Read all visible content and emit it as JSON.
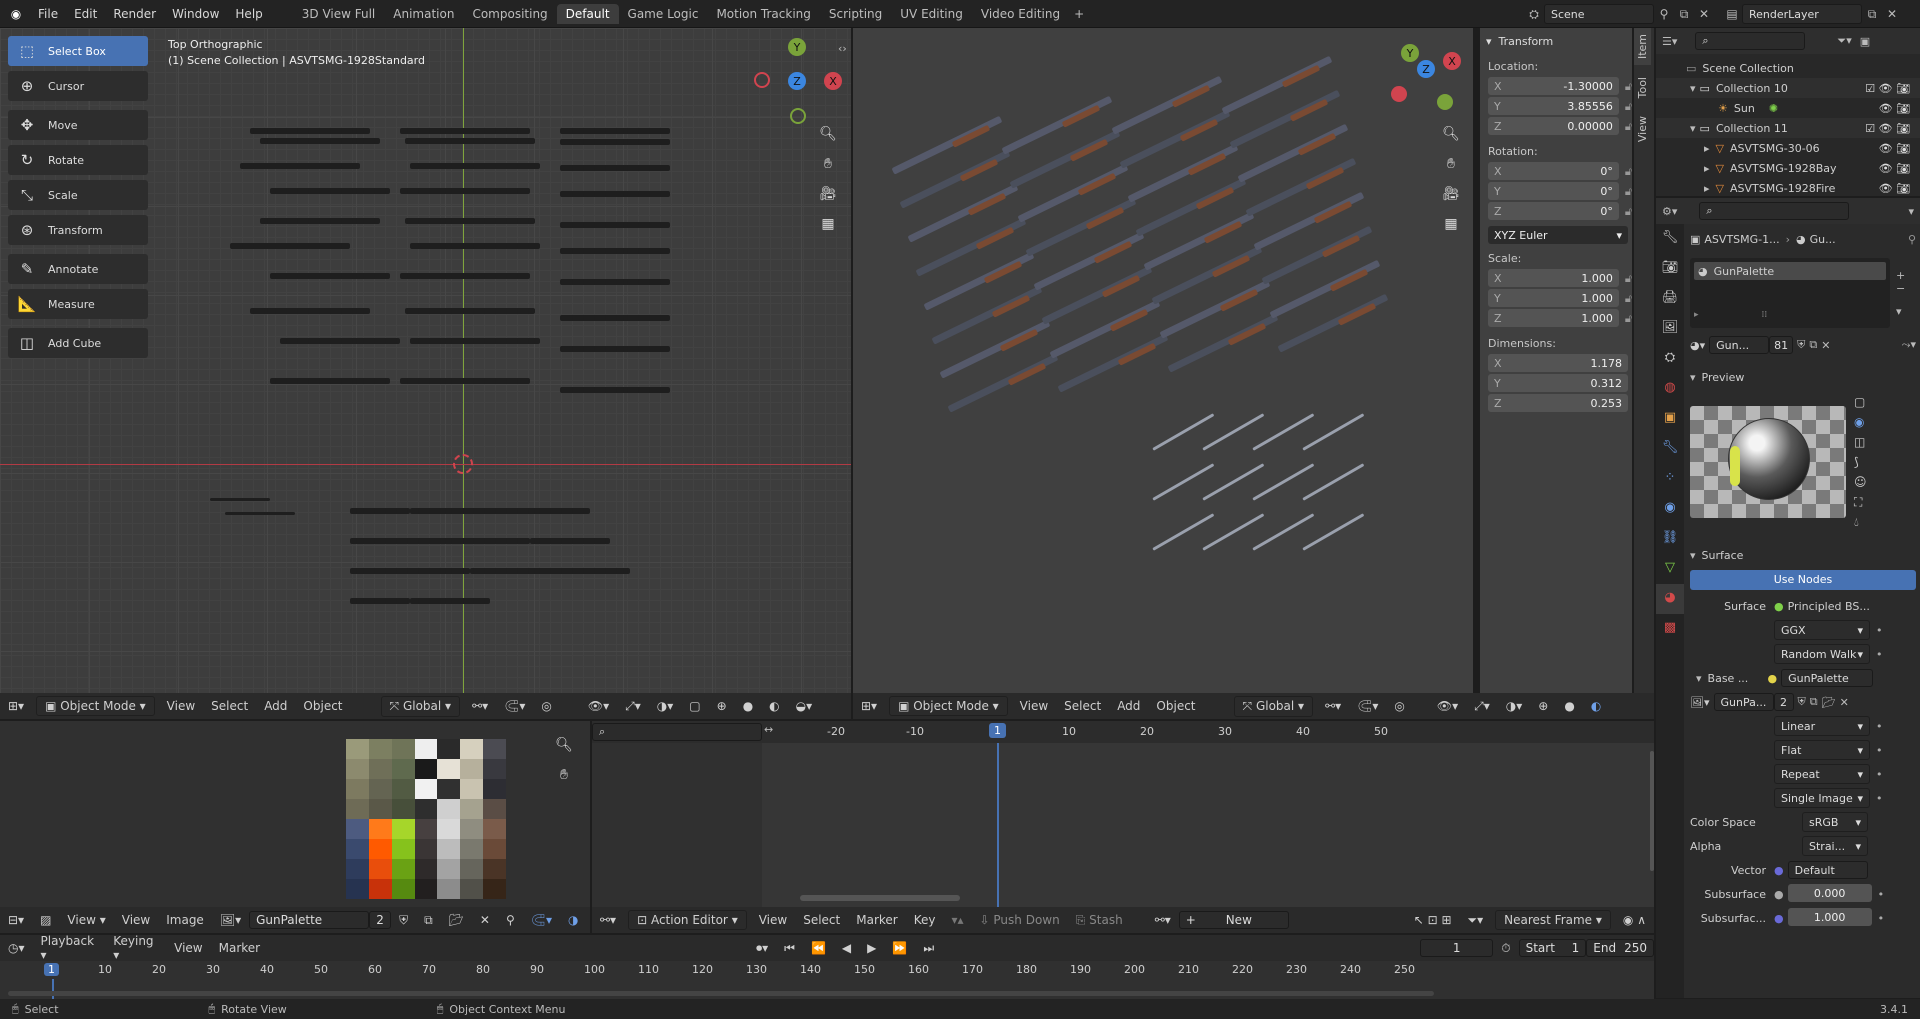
{
  "top_menu": [
    "File",
    "Edit",
    "Render",
    "Window",
    "Help"
  ],
  "workspaces": [
    "3D View Full",
    "Animation",
    "Compositing",
    "Default",
    "Game Logic",
    "Motion Tracking",
    "Scripting",
    "UV Editing",
    "Video Editing"
  ],
  "active_workspace": "Default",
  "scene": {
    "name": "Scene",
    "render_layer": "RenderLayer"
  },
  "left_viewport": {
    "view_name": "Top Orthographic",
    "collection_text": "(1) Scene Collection | ASVTSMG-1928Standard",
    "tools": [
      "Select Box",
      "Cursor",
      "Move",
      "Rotate",
      "Scale",
      "Transform",
      "Annotate",
      "Measure",
      "Add Cube"
    ],
    "header": {
      "mode": "Object Mode",
      "menus": [
        "View",
        "Select",
        "Add",
        "Object"
      ],
      "orientation": "Global"
    },
    "gizmo": {
      "y": "Y",
      "z": "Z",
      "x": "X"
    }
  },
  "right_viewport": {
    "header": {
      "mode": "Object Mode",
      "menus": [
        "View",
        "Select",
        "Add",
        "Object"
      ],
      "orientation": "Global"
    },
    "side_tabs": [
      "Item",
      "Tool",
      "View"
    ],
    "transform": {
      "title": "Transform",
      "location_label": "Location:",
      "location": {
        "x": "-1.30000",
        "y": "3.85556",
        "z": "0.00000"
      },
      "rotation_label": "Rotation:",
      "rotation": {
        "x": "0°",
        "y": "0°",
        "z": "0°"
      },
      "rotation_mode": "XYZ Euler",
      "scale_label": "Scale:",
      "scale": {
        "x": "1.000",
        "y": "1.000",
        "z": "1.000"
      },
      "dimensions_label": "Dimensions:",
      "dimensions": {
        "x": "1.178",
        "y": "0.312",
        "z": "0.253"
      },
      "axis_labels": {
        "x": "X",
        "y": "Y",
        "z": "Z"
      }
    }
  },
  "outliner": {
    "items": [
      {
        "name": "Scene Collection",
        "indent": 0
      },
      {
        "name": "Collection 10",
        "indent": 1
      },
      {
        "name": "Sun",
        "indent": 2
      },
      {
        "name": "Collection 11",
        "indent": 1
      },
      {
        "name": "ASVTSMG-30-06",
        "indent": 2
      },
      {
        "name": "ASVTSMG-1928Bay",
        "indent": 2
      },
      {
        "name": "ASVTSMG-1928Fire",
        "indent": 2
      }
    ]
  },
  "properties": {
    "breadcrumb_object": "ASVTSMG-1...",
    "breadcrumb_material": "Gu...",
    "material_slot": "GunPalette",
    "material_name": "Gun...",
    "material_users": "81",
    "preview_label": "Preview",
    "surface_section": "Surface",
    "use_nodes": "Use Nodes",
    "surface_label": "Surface",
    "surface_value": "Principled BS...",
    "distribution": "GGX",
    "subsurface_method": "Random Walk",
    "base_color_label": "Base ...",
    "base_color_value": "GunPalette",
    "image_name": "GunPa...",
    "image_users": "2",
    "interpolation": "Linear",
    "projection": "Flat",
    "extension": "Repeat",
    "source": "Single Image",
    "color_space_label": "Color Space",
    "color_space": "sRGB",
    "alpha_label": "Alpha",
    "alpha_value": "Strai...",
    "vector_label": "Vector",
    "vector_value": "Default",
    "subsurface_label": "Subsurface",
    "subsurface_value": "0.000",
    "subsurface2_label": "Subsurfac...",
    "subsurface2_value": "1.000"
  },
  "image_editor": {
    "menus": [
      "View",
      "View",
      "Image"
    ],
    "image_name": "GunPalette",
    "users": "2",
    "palette": [
      [
        "#9a9a7a",
        "#7c7f61",
        "#6f7458",
        "#eeeeee",
        "#2a2a2a",
        "#d6d0be",
        "#4b4b52"
      ],
      [
        "#8c8a6e",
        "#6f6f58",
        "#5f6a4e",
        "#1a1a1a",
        "#e6e1d6",
        "#b6b09c",
        "#39393f"
      ],
      [
        "#7d7a60",
        "#646452",
        "#525b43",
        "#f1f1f1",
        "#303030",
        "#c9c3b0",
        "#2d2d33"
      ],
      [
        "#6e6b56",
        "#5a5848",
        "#474f3a",
        "#2e2e2e",
        "#cfcfcf",
        "#a5a28f",
        "#5a4d45"
      ],
      [
        "#4d5b80",
        "#ff7a1a",
        "#a6d62a",
        "#474040",
        "#d9d9d9",
        "#8f8d80",
        "#7a5b4a"
      ],
      [
        "#3a4a6e",
        "#ff5a00",
        "#86c21c",
        "#3a3535",
        "#bcbcbc",
        "#7a796e",
        "#6a4a38"
      ],
      [
        "#2e3c5c",
        "#e94e0c",
        "#6aa214",
        "#2e2a2a",
        "#a3a3a3",
        "#66655c",
        "#4a3426"
      ],
      [
        "#263350",
        "#c8320a",
        "#568a10",
        "#221f1f",
        "#8c8c8c",
        "#515049",
        "#362518"
      ]
    ]
  },
  "action_editor": {
    "mode": "Action Editor",
    "menus": [
      "View",
      "Select",
      "Marker",
      "Key"
    ],
    "push_down": "Push Down",
    "stash": "Stash",
    "new": "New",
    "snap": "Nearest Frame",
    "ruler": [
      "-20",
      "-10",
      "1",
      "10",
      "20",
      "30",
      "40",
      "50"
    ]
  },
  "timeline": {
    "menus": [
      "Playback",
      "Keying",
      "View",
      "Marker"
    ],
    "current_frame": "1",
    "start_label": "Start",
    "start": "1",
    "end_label": "End",
    "end": "250",
    "ruler": [
      "1",
      "10",
      "20",
      "30",
      "40",
      "50",
      "60",
      "70",
      "80",
      "90",
      "100",
      "110",
      "120",
      "130",
      "140",
      "150",
      "160",
      "170",
      "180",
      "190",
      "200",
      "210",
      "220",
      "230",
      "240",
      "250"
    ]
  },
  "status_bar": {
    "select": "Select",
    "rotate": "Rotate View",
    "context": "Object Context Menu",
    "version": "3.4.1"
  }
}
